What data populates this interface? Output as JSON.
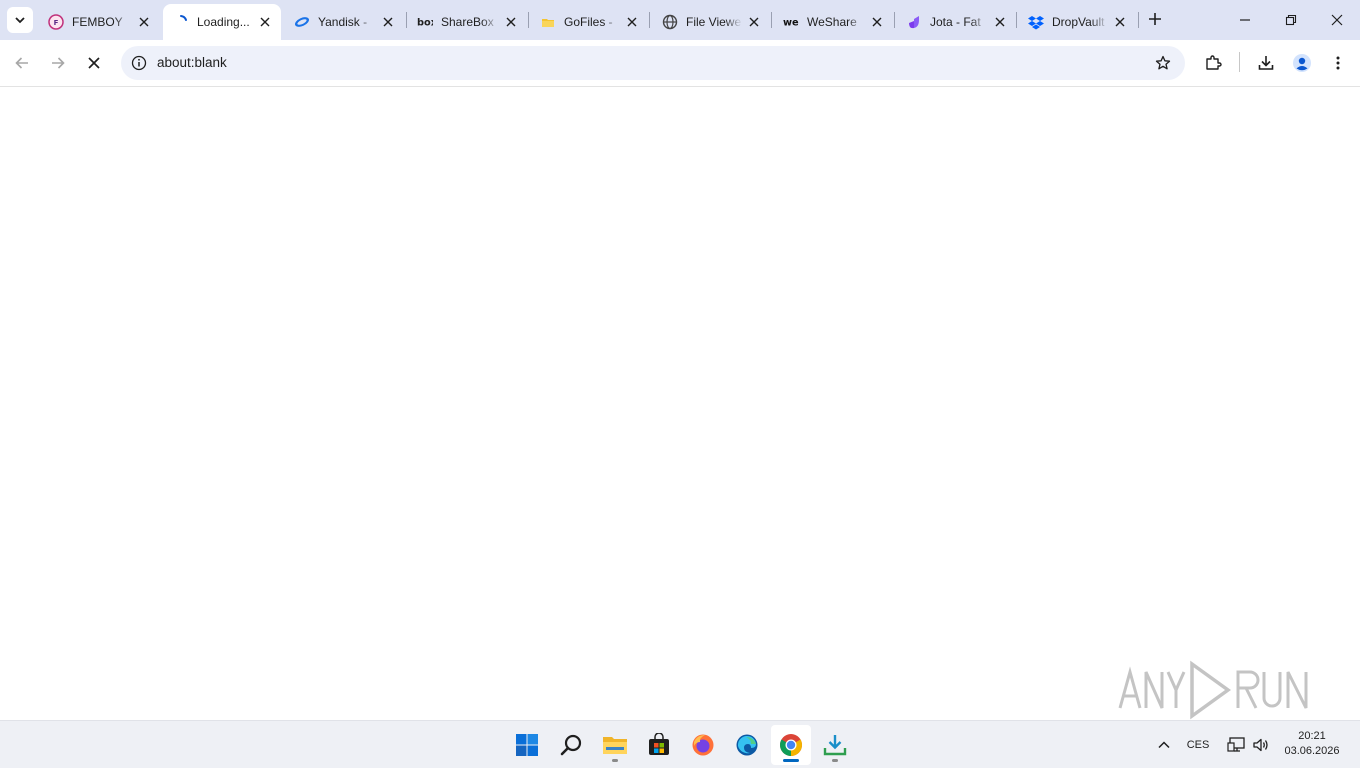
{
  "browser": {
    "tabs": [
      {
        "title": "FEMBOY",
        "favicon": "femboy-favicon",
        "active": false
      },
      {
        "title": "Loading...",
        "favicon": "loading-spinner",
        "active": true
      },
      {
        "title": "Yandisk -",
        "favicon": "yandisk-favicon",
        "active": false
      },
      {
        "title": "ShareBox",
        "favicon": "box-favicon",
        "active": false
      },
      {
        "title": "GoFiles -",
        "favicon": "gofiles-favicon",
        "active": false
      },
      {
        "title": "File Viewe",
        "favicon": "globe-favicon",
        "active": false
      },
      {
        "title": "WeShare",
        "favicon": "weshare-favicon",
        "active": false
      },
      {
        "title": "Jota - Fat",
        "favicon": "jota-favicon",
        "active": false
      },
      {
        "title": "DropVault",
        "favicon": "dropbox-favicon",
        "active": false
      }
    ],
    "address_bar": {
      "url": "about:blank"
    },
    "toolbar_icons": [
      "back-icon",
      "forward-icon",
      "stop-icon",
      "info-icon",
      "star-icon",
      "extensions-icon",
      "download-icon",
      "profile-icon",
      "menu-icon"
    ]
  },
  "watermark": {
    "text": "ANY RUN"
  },
  "taskbar": {
    "apps": [
      "windows-start-icon",
      "search-icon",
      "file-explorer-icon",
      "store-icon",
      "firefox-icon",
      "edge-icon",
      "chrome-icon",
      "downloader-icon"
    ],
    "tray": {
      "language": "CES",
      "time": "20:21",
      "date": "03.06.2026"
    }
  },
  "colors": {
    "tabstrip": "#dee3f4",
    "omnibox": "#eef1fa",
    "taskbar": "#eef0f5",
    "accent": "#0b57d0"
  }
}
